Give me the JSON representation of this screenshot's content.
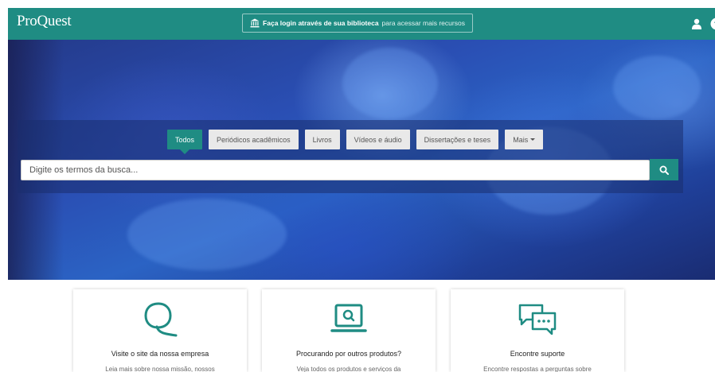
{
  "header": {
    "logo": "ProQuest",
    "login_bold": "Faça login através de sua biblioteca",
    "login_rest": "para acessar mais recursos",
    "icons": [
      "bank-icon",
      "user-icon",
      "help-icon"
    ]
  },
  "search": {
    "tabs": [
      {
        "label": "Todos",
        "active": true
      },
      {
        "label": "Periódicos acadêmicos",
        "active": false
      },
      {
        "label": "Livros",
        "active": false
      },
      {
        "label": "Vídeos e áudio",
        "active": false
      },
      {
        "label": "Dissertações e teses",
        "active": false
      },
      {
        "label": "Mais",
        "active": false
      }
    ],
    "placeholder": "Digite os termos da busca...",
    "button_icon": "search-icon"
  },
  "cards": [
    {
      "icon": "proquest-q-icon",
      "title": "Visite o site da nossa empresa",
      "text": "Leia mais sobre nossa missão, nossos"
    },
    {
      "icon": "laptop-search-icon",
      "title": "Procurando por outros produtos?",
      "text": "Veja todos os produtos e serviços da"
    },
    {
      "icon": "chat-bubbles-icon",
      "title": "Encontre suporte",
      "text": "Encontre respostas a perguntas sobre"
    }
  ],
  "colors": {
    "brand_teal": "#1f8c83",
    "tab_background": "#e9e9e9",
    "hero_blue": "#2b63c4"
  }
}
